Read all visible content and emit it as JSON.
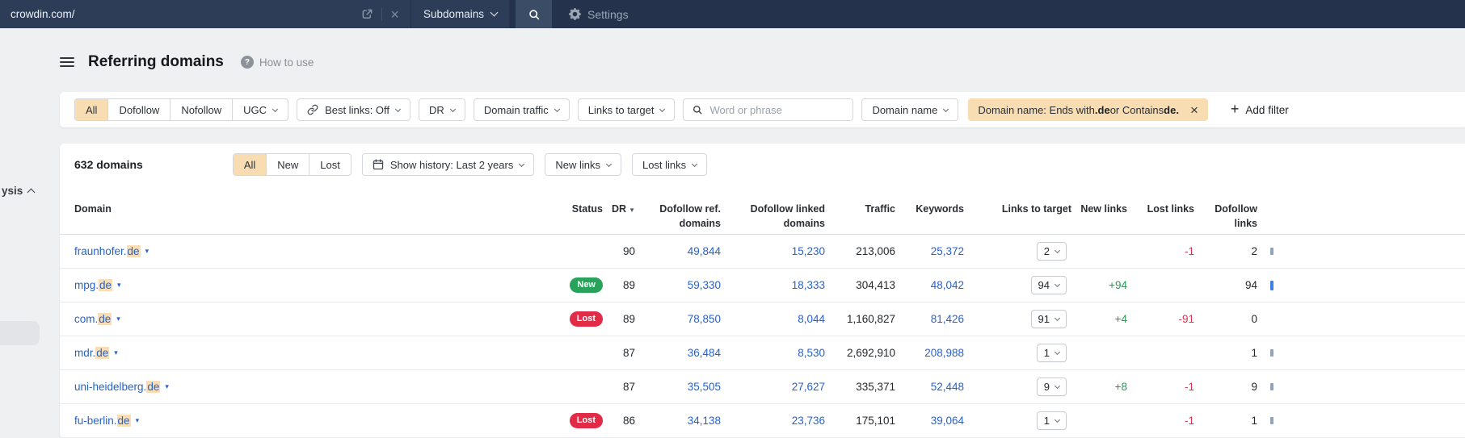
{
  "topbar": {
    "url_value": "crowdin.com/",
    "mode_label": "Subdomains",
    "settings_label": "Settings"
  },
  "sidebar": {
    "cut_label": "ysis"
  },
  "header": {
    "title": "Referring domains",
    "help_label": "How to use"
  },
  "filters": {
    "segments": {
      "all": "All",
      "dofollow": "Dofollow",
      "nofollow": "Nofollow",
      "ugc": "UGC"
    },
    "best_links_label": "Best links: Off",
    "dr_label": "DR",
    "domain_traffic_label": "Domain traffic",
    "links_to_target_label": "Links to target",
    "search_placeholder": "Word or phrase",
    "domain_name_label": "Domain name",
    "active_filter": {
      "prefix": "Domain name: Ends with ",
      "bold1": ".de",
      "middle": " or Contains ",
      "bold2": "de."
    },
    "add_filter_label": "Add filter"
  },
  "toolbar": {
    "count_label": "632 domains",
    "segments": {
      "all": "All",
      "new": "New",
      "lost": "Lost"
    },
    "show_history_label": "Show history: Last 2 years",
    "new_links_label": "New links",
    "lost_links_label": "Lost links"
  },
  "table": {
    "headers": {
      "domain": "Domain",
      "status": "Status",
      "dr": "DR",
      "dofollow_ref": "Dofollow ref. domains",
      "dofollow_linked": "Dofollow linked domains",
      "traffic": "Traffic",
      "keywords": "Keywords",
      "links_to_target": "Links to target",
      "new_links": "New links",
      "lost_links": "Lost links",
      "dofollow_links": "Dofollow links"
    },
    "rows": [
      {
        "domain_prefix": "fraunhofer.",
        "domain_highlight": "de",
        "status": "",
        "status_type": "",
        "dr": "90",
        "dofollow_ref": "49,844",
        "dofollow_linked": "15,230",
        "traffic": "213,006",
        "keywords": "25,372",
        "links_select": "2",
        "new_links": "",
        "lost_links": "-1",
        "dofollow_links": "2",
        "spark": "s"
      },
      {
        "domain_prefix": "mpg.",
        "domain_highlight": "de",
        "status": "New",
        "status_type": "new",
        "dr": "89",
        "dofollow_ref": "59,330",
        "dofollow_linked": "18,333",
        "traffic": "304,413",
        "keywords": "48,042",
        "links_select": "94",
        "new_links": "+94",
        "lost_links": "",
        "dofollow_links": "94",
        "spark": "m"
      },
      {
        "domain_prefix": "com.",
        "domain_highlight": "de",
        "status": "Lost",
        "status_type": "lost",
        "dr": "89",
        "dofollow_ref": "78,850",
        "dofollow_linked": "8,044",
        "traffic": "1,160,827",
        "keywords": "81,426",
        "links_select": "91",
        "new_links": "+4",
        "lost_links": "-91",
        "dofollow_links": "0",
        "spark": ""
      },
      {
        "domain_prefix": "mdr.",
        "domain_highlight": "de",
        "status": "",
        "status_type": "",
        "dr": "87",
        "dofollow_ref": "36,484",
        "dofollow_linked": "8,530",
        "traffic": "2,692,910",
        "keywords": "208,988",
        "links_select": "1",
        "new_links": "",
        "lost_links": "",
        "dofollow_links": "1",
        "spark": "s"
      },
      {
        "domain_prefix": "uni-heidelberg.",
        "domain_highlight": "de",
        "status": "",
        "status_type": "",
        "dr": "87",
        "dofollow_ref": "35,505",
        "dofollow_linked": "27,627",
        "traffic": "335,371",
        "keywords": "52,448",
        "links_select": "9",
        "new_links": "+8",
        "lost_links": "-1",
        "dofollow_links": "9",
        "spark": "s"
      },
      {
        "domain_prefix": "fu-berlin.",
        "domain_highlight": "de",
        "status": "Lost",
        "status_type": "lost",
        "dr": "86",
        "dofollow_ref": "34,138",
        "dofollow_linked": "23,736",
        "traffic": "175,101",
        "keywords": "39,064",
        "links_select": "1",
        "new_links": "",
        "lost_links": "-1",
        "dofollow_links": "1",
        "spark": "s"
      }
    ]
  },
  "colors": {
    "topbar_bg": "#24334b",
    "accent_peach": "#f8dcb2",
    "link_blue": "#2463cf",
    "positive_green": "#1e9e52",
    "negative_red": "#d6344f",
    "badge_new_bg": "#29a35c",
    "badge_lost_bg": "#e22b47"
  }
}
